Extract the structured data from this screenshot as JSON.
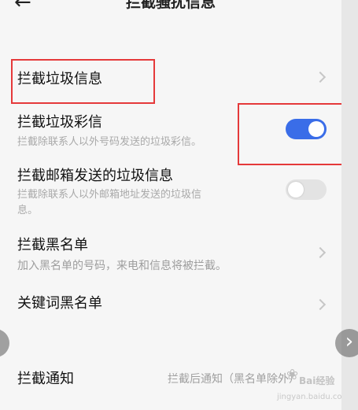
{
  "header": {
    "back_icon": "back-arrow-icon",
    "title": "拦截骚扰信息"
  },
  "rows": {
    "spam_sms": {
      "title": "拦截垃圾信息"
    },
    "spam_mms": {
      "title": "拦截垃圾彩信",
      "subtitle": "拦截除联系人以外号码发送的垃圾彩信。",
      "enabled": true
    },
    "email_spam": {
      "title": "拦截邮箱发送的垃圾信息",
      "subtitle_line1": "拦截除联系人以外邮箱地址发送的垃圾信",
      "subtitle_line2": "息。",
      "enabled": false
    },
    "blacklist": {
      "title": "拦截黑名单",
      "subtitle": "加入黑名单的号码，来电和信息将被拦截。"
    },
    "keyword_blacklist": {
      "title": "关键词黑名单"
    },
    "notification": {
      "title": "拦截通知",
      "value": "拦截后通知（黑名单除外）"
    }
  },
  "colors": {
    "toggle_on": "#3a6de8",
    "highlight_border": "#e5393a"
  },
  "watermark": {
    "brand": "Bai经验",
    "url": "jingyan.baidu.com"
  },
  "nav": {
    "next_icon": "chevron-right-icon",
    "prev_icon": "chevron-left-icon"
  }
}
